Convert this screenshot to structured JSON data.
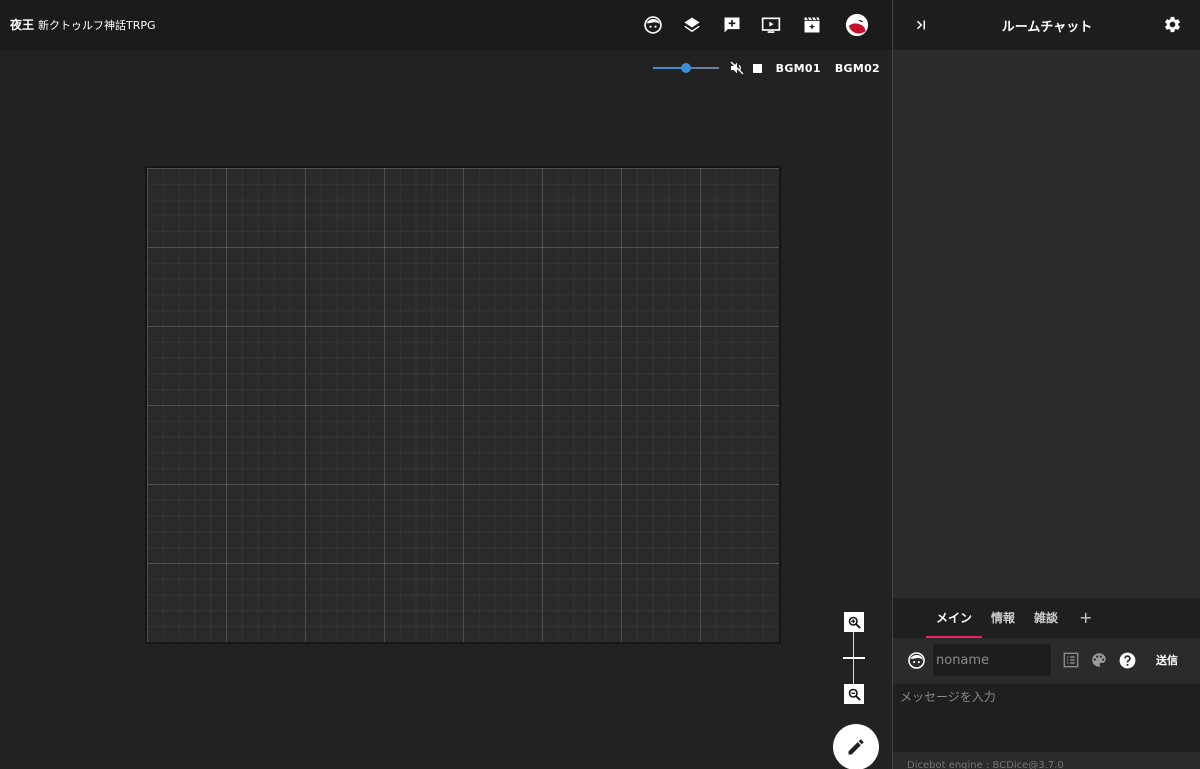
{
  "header": {
    "brand": "夜王",
    "room_name": "新クトゥルフ神話TRPG",
    "icons": [
      "face-icon",
      "layers-icon",
      "add-comment-icon",
      "screen-play-icon",
      "movie-edit-icon",
      "user-avatar-icon"
    ]
  },
  "bgm": {
    "volume_percent": 50,
    "buttons": [
      "BGM01",
      "BGM02"
    ],
    "accent_color": "#3d8fd6"
  },
  "chat": {
    "title": "ルームチャット",
    "tabs": [
      {
        "label": "メイン",
        "active": true
      },
      {
        "label": "情報",
        "active": false
      },
      {
        "label": "雑談",
        "active": false
      }
    ],
    "add_tab_label": "+",
    "name_placeholder": "noname",
    "send_label": "送信",
    "message_placeholder": "メッセージを入力",
    "footer": "Dicebot engine : BCDice@3.7.0",
    "accent_color": "#e91e63"
  },
  "zoom": {
    "level_fraction": 0.5
  }
}
